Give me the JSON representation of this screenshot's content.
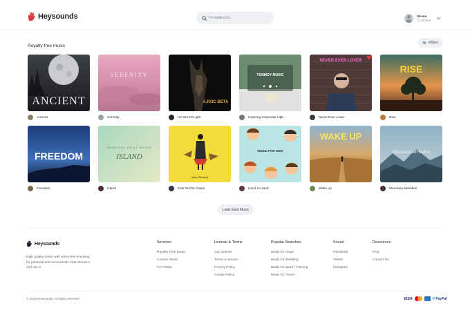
{
  "header": {
    "brand": "Heysounds",
    "search_placeholder": "I'm looking for...",
    "user_name": "Bruno",
    "user_role": "Customer"
  },
  "section": {
    "title": "Royalty-free music",
    "filters_label": "Filters"
  },
  "tracks": [
    {
      "title": "Ancient",
      "cover_text": "ANCIENT"
    },
    {
      "title": "Serenity",
      "cover_text": "SERENITY"
    },
    {
      "title": "I'm Out Of Light",
      "cover_text": "A.ROC BETA"
    },
    {
      "title": "Inspiring Corporate Upb...",
      "cover_text": "TONMOY MUSIC"
    },
    {
      "title": "Never Ever Lover",
      "cover_text": "NEVER EVER LOVER",
      "favorited": true
    },
    {
      "title": "Rise",
      "cover_text": "RISE"
    },
    {
      "title": "Freedom",
      "cover_text": "FREEDOM"
    },
    {
      "title": "Island",
      "cover_text": "ISLAND",
      "cover_subtext": "TROPICAL CHILL MUSIC"
    },
    {
      "title": "Kids Puzzle Game",
      "cover_text": "Annie Deminal"
    },
    {
      "title": "Hand In Hand",
      "cover_text": "MUSIC FOR KIDS"
    },
    {
      "title": "Wake up",
      "cover_text": "WAKE UP"
    },
    {
      "title": "Mountain Melodies",
      "cover_text": "Mountain Melodies"
    }
  ],
  "load_more_label": "Load more Music",
  "footer": {
    "brand": "Heysounds",
    "description": "High quality music with worry-free licensing for personal and commercial. Just choose it and use it.",
    "columns": [
      {
        "heading": "Services",
        "links": [
          "Royalty-Free Music",
          "Custom Music",
          "For Artists"
        ]
      },
      {
        "heading": "License & Terms",
        "links": [
          "Our License",
          "Terms & Service",
          "Privacy Policy",
          "Cookie Policy"
        ]
      },
      {
        "heading": "Popular Searches",
        "links": [
          "Music for Vlogs",
          "Music for Wedding",
          "Music for Sport / Training",
          "Music for Travel"
        ]
      },
      {
        "heading": "Social",
        "links": [
          "Facebook",
          "Twitter",
          "Instagram"
        ]
      },
      {
        "heading": "Resources",
        "links": [
          "FAQ",
          "Contact Us"
        ]
      }
    ],
    "copyright": "© 2023 Heysounds. All rights reserved.",
    "payments": {
      "visa": "VISA",
      "paypal_a": "P",
      "paypal_b": "PayPal"
    }
  },
  "colors": {
    "accent_heart": "#e53935",
    "brand_mark": "#e03a3a"
  }
}
